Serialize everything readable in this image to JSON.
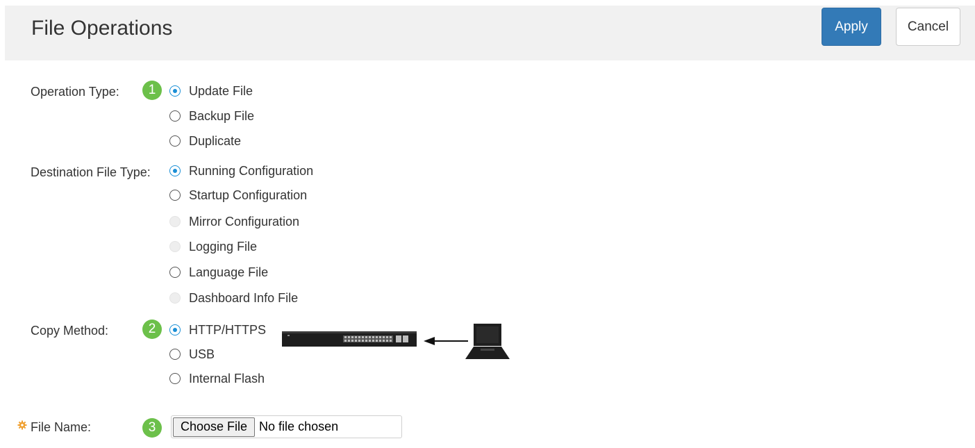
{
  "header": {
    "title": "File Operations",
    "apply_label": "Apply",
    "cancel_label": "Cancel"
  },
  "operation_type": {
    "label": "Operation Type:",
    "step": "1",
    "options": [
      {
        "label": "Update File",
        "checked": true
      },
      {
        "label": "Backup File",
        "checked": false
      },
      {
        "label": "Duplicate",
        "checked": false
      }
    ]
  },
  "destination_file_type": {
    "label": "Destination File Type:",
    "options": [
      {
        "label": "Running Configuration",
        "checked": true,
        "disabled": false
      },
      {
        "label": "Startup Configuration",
        "checked": false,
        "disabled": false
      },
      {
        "label": "Mirror Configuration",
        "checked": false,
        "disabled": true
      },
      {
        "label": "Logging File",
        "checked": false,
        "disabled": true
      },
      {
        "label": "Language File",
        "checked": false,
        "disabled": false
      },
      {
        "label": "Dashboard Info File",
        "checked": false,
        "disabled": true
      }
    ]
  },
  "copy_method": {
    "label": "Copy Method:",
    "step": "2",
    "options": [
      {
        "label": "HTTP/HTTPS",
        "checked": true
      },
      {
        "label": "USB",
        "checked": false
      },
      {
        "label": "Internal Flash",
        "checked": false
      }
    ]
  },
  "file_name": {
    "label": "File Name:",
    "step": "3",
    "choose_label": "Choose File",
    "status": "No file chosen",
    "required_icon": "asterisk-gear-icon"
  },
  "colors": {
    "accent": "#337ab7",
    "step_badge": "#6cc04a",
    "radio_selected": "#1a8fd6",
    "required": "#f0a030"
  },
  "icons": {
    "switch": "network-switch-icon",
    "arrow": "arrow-left-icon",
    "computer": "laptop-icon"
  }
}
